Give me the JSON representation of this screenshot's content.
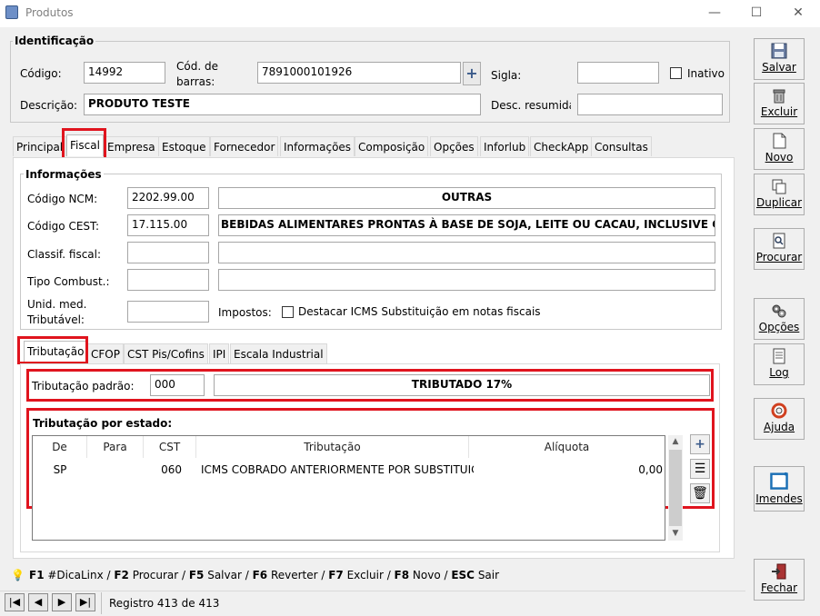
{
  "window": {
    "title": "Produtos",
    "minimize": "—",
    "maximize": "☐",
    "close": "✕"
  },
  "identificacao": {
    "legend": "Identificação",
    "codigo_label": "Código:",
    "codigo_value": "14992",
    "codbarras_label_1": "Cód. de",
    "codbarras_label_2": "barras:",
    "codbarras_value": "7891000101926",
    "sigla_label": "Sigla:",
    "sigla_value": "",
    "inativo_label": "Inativo",
    "descricao_label": "Descrição:",
    "descricao_value": "PRODUTO TESTE",
    "desc_resumida_label": "Desc. resumida:",
    "desc_resumida_value": ""
  },
  "tabs": [
    "Principal",
    "Fiscal",
    "Empresa",
    "Estoque",
    "Fornecedor",
    "Informações",
    "Composição",
    "Opções",
    "Inforlub",
    "CheckApp",
    "Consultas"
  ],
  "informacoes": {
    "legend": "Informações",
    "ncm_label": "Código NCM:",
    "ncm_value": "2202.99.00",
    "ncm_desc": "OUTRAS",
    "cest_label": "Código CEST:",
    "cest_value": "17.115.00",
    "cest_desc": "BEBIDAS ALIMENTARES PRONTAS À BASE DE SOJA, LEITE OU CACAU, INCLUSIVE OS PRO",
    "classif_label": "Classif. fiscal:",
    "tipo_comb_label": "Tipo Combust.:",
    "unid_label_1": "Unid. med.",
    "unid_label_2": "Tributável:",
    "impostos_label": "Impostos:",
    "destacar_label": "Destacar ICMS Substituição em notas fiscais"
  },
  "subtabs": [
    "Tributação",
    "CFOP",
    "CST Pis/Cofins",
    "IPI",
    "Escala Industrial"
  ],
  "tributacao": {
    "padrao_label": "Tributação padrão:",
    "padrao_code": "000",
    "padrao_desc": "TRIBUTADO 17%",
    "por_estado_label": "Tributação por estado:",
    "columns": [
      "De",
      "Para",
      "CST",
      "Tributação",
      "Alíquota"
    ],
    "rows": [
      {
        "de": "SP",
        "para": "",
        "cst": "060",
        "tributacao": "ICMS COBRADO ANTERIORMENTE POR SUBSTITUIÇÃO",
        "aliquota": "0,00"
      }
    ]
  },
  "shortcuts": [
    {
      "key": "F1",
      "label": " #DicaLinx"
    },
    {
      "key": "F2",
      "label": " Procurar"
    },
    {
      "key": "F5",
      "label": " Salvar"
    },
    {
      "key": "F6",
      "label": " Reverter"
    },
    {
      "key": "F7",
      "label": " Excluir"
    },
    {
      "key": "F8",
      "label": " Novo"
    },
    {
      "key": "ESC",
      "label": " Sair"
    }
  ],
  "status": {
    "registro": "Registro 413 de 413"
  },
  "sidebar": {
    "salvar": "Salvar",
    "excluir": "Excluir",
    "novo": "Novo",
    "duplicar": "Duplicar",
    "procurar": "Procurar",
    "opcoes": "Opções",
    "log": "Log",
    "ajuda": "Ajuda",
    "imendes": "Imendes",
    "fechar": "Fechar"
  }
}
